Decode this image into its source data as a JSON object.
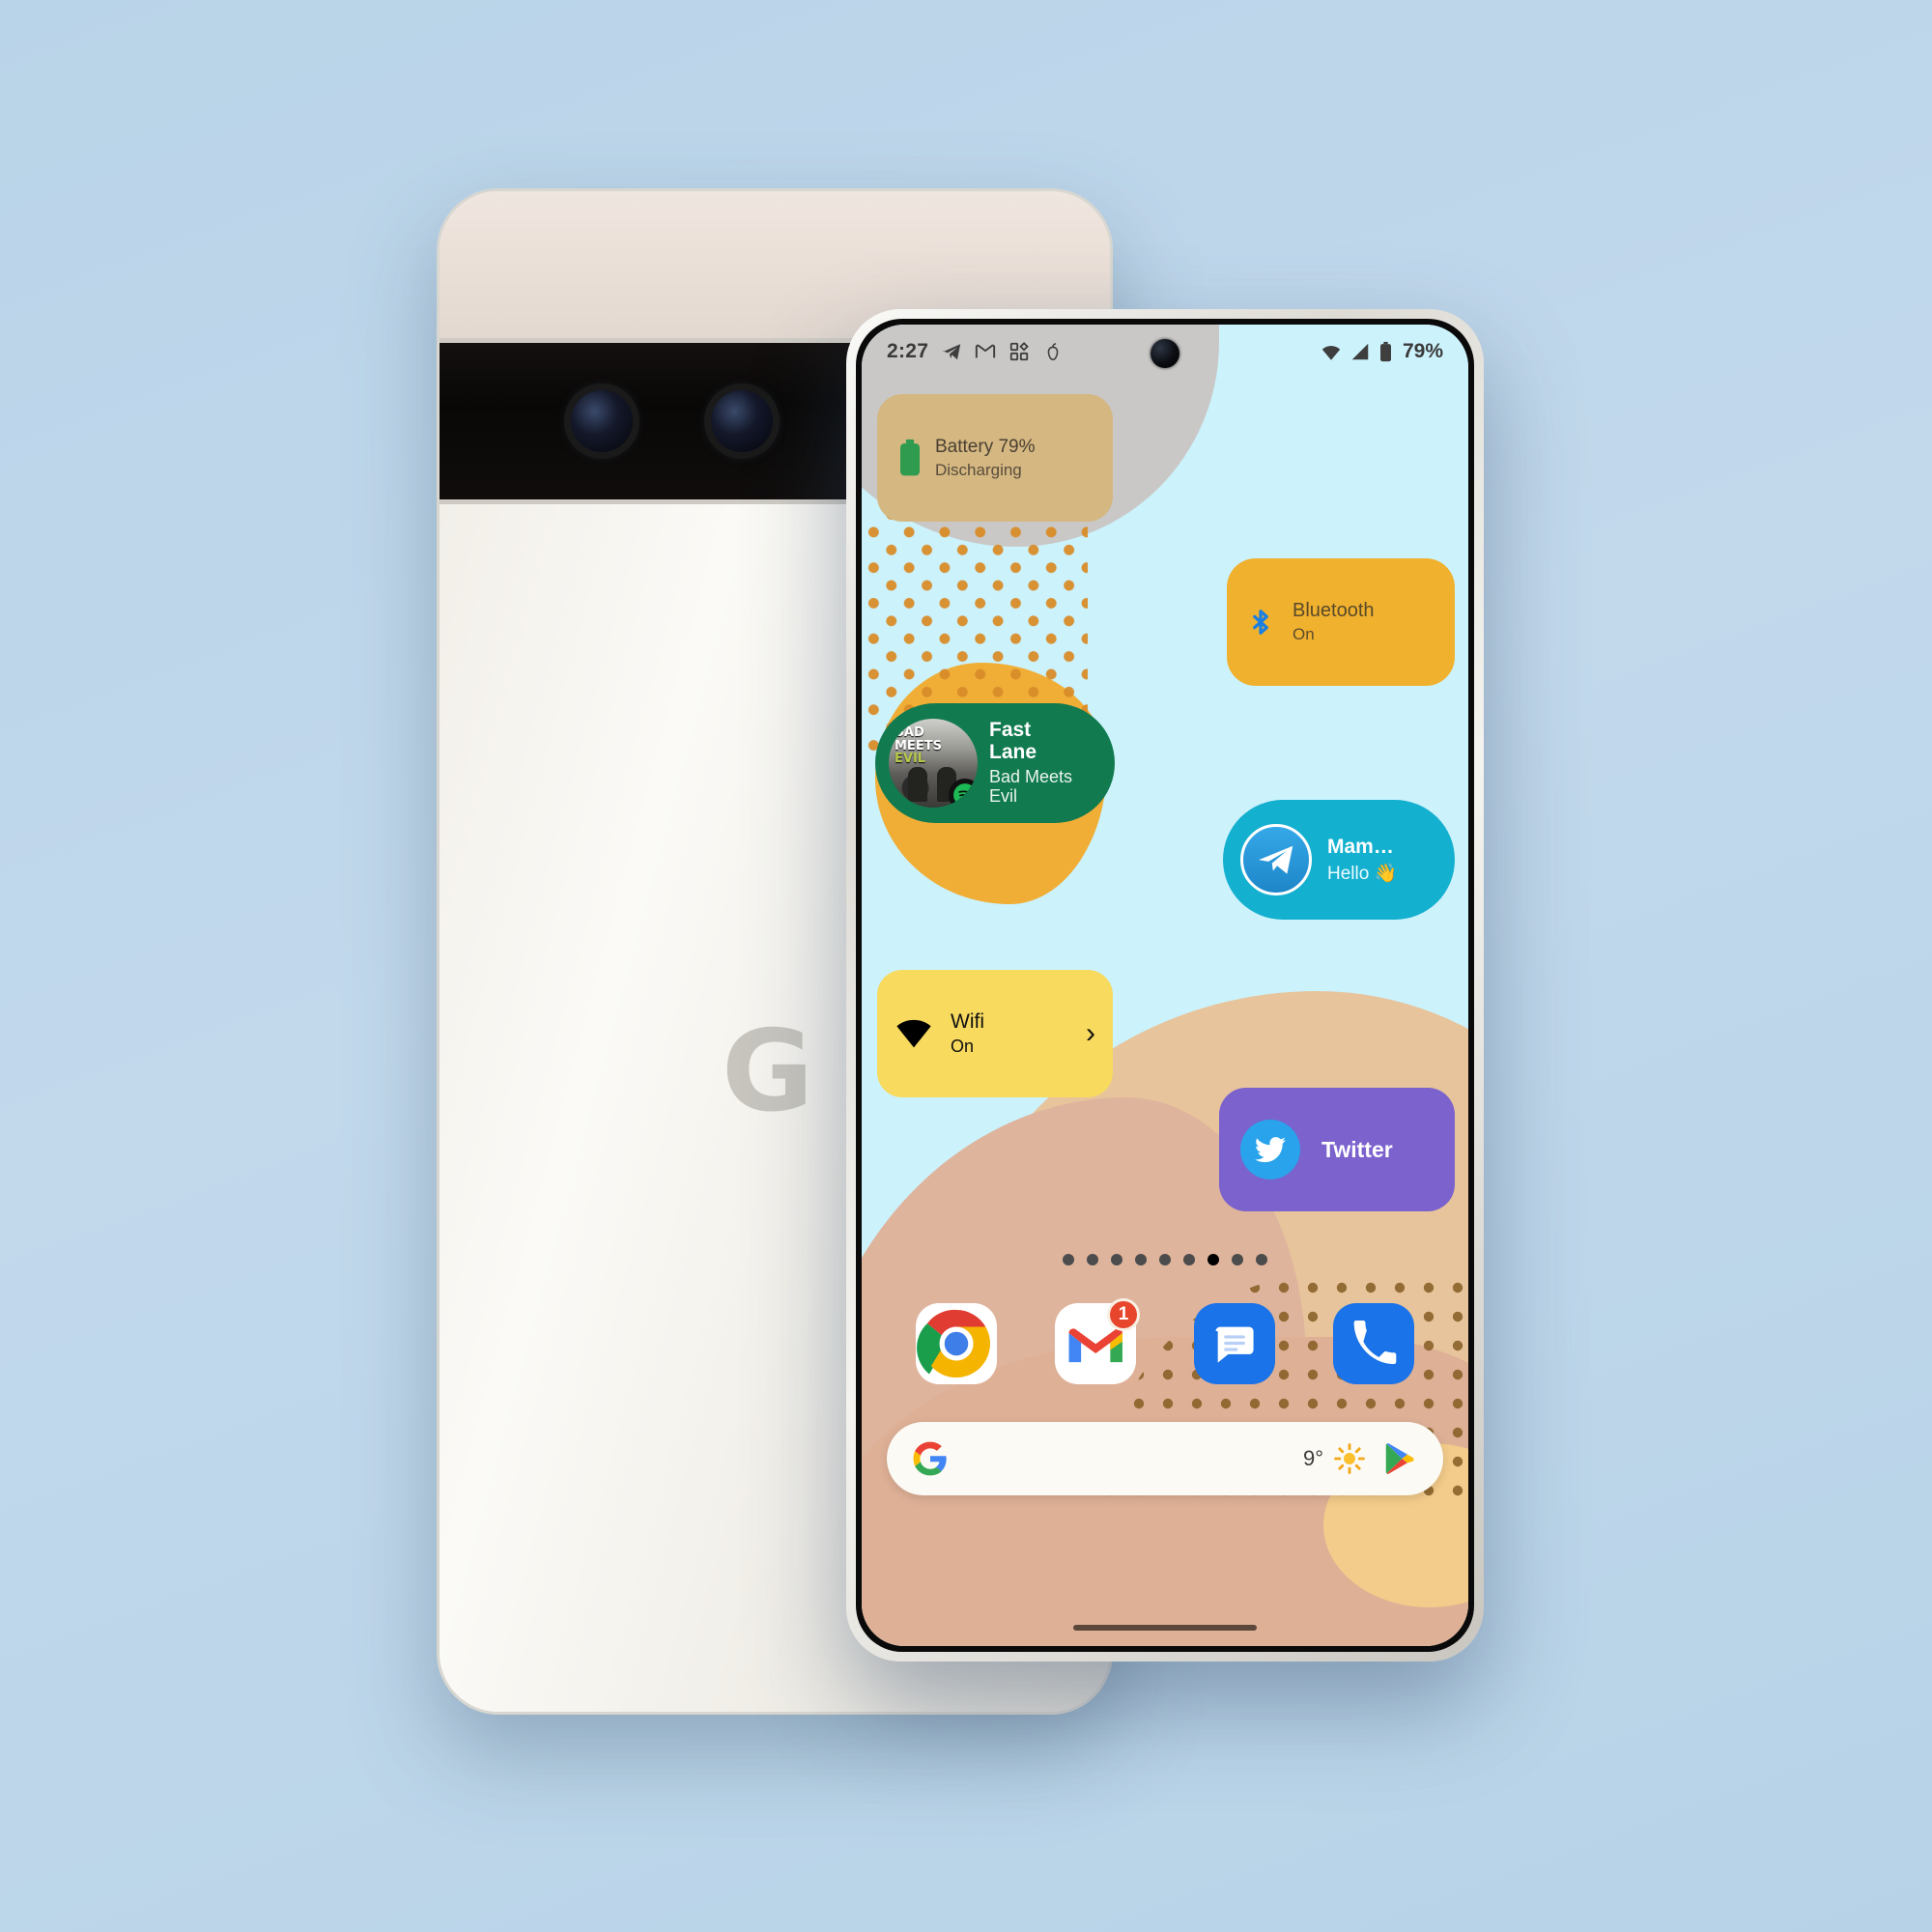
{
  "scene": {
    "background_color": "#bdd5e9",
    "back_device": {
      "name": "pixel-6-pro-back",
      "brand_mark": "G",
      "color": "#f2efe9"
    }
  },
  "status_bar": {
    "clock": "2:27",
    "notification_icons": [
      "telegram-icon",
      "gmail-icon",
      "apps-grid-icon",
      "apple-outline-icon"
    ],
    "system_icons": [
      "wifi-icon",
      "cellular-signal-icon",
      "battery-icon"
    ],
    "battery_percent": "79%"
  },
  "widgets": {
    "battery": {
      "title": "Battery 79%",
      "subtitle": "Discharging",
      "icon": "battery-icon",
      "color": "#d4b781"
    },
    "bluetooth": {
      "title": "Bluetooth",
      "subtitle": "On",
      "icon": "bluetooth-icon",
      "color": "#f0b12e"
    },
    "spotify": {
      "song": "Fast Lane",
      "artist": "Bad Meets Evil",
      "album_art_line1": "BAD",
      "album_art_line2": "MEETS",
      "album_art_line3": "EVIL",
      "icon": "spotify-icon",
      "color": "#127a4f"
    },
    "telegram": {
      "contact": "Mam…",
      "message": "Hello 👋",
      "icon": "telegram-icon",
      "color": "#14b0cf"
    },
    "wifi": {
      "title": "Wifi",
      "subtitle": "On",
      "icon": "wifi-icon",
      "chevron": "›",
      "color": "#f7da5e"
    },
    "twitter": {
      "label": "Twitter",
      "icon": "twitter-icon",
      "color": "#7b62cd"
    }
  },
  "home_screen": {
    "page_dots": {
      "count": 9,
      "active_index": 6
    },
    "dock": [
      {
        "label": "Chrome",
        "icon": "chrome-icon"
      },
      {
        "label": "Gmail",
        "icon": "gmail-icon",
        "badge": "1"
      },
      {
        "label": "Messages",
        "icon": "messages-icon"
      },
      {
        "label": "Phone",
        "icon": "phone-icon"
      }
    ],
    "search_bar": {
      "logo": "google-g-icon",
      "temperature": "9°",
      "weather_icon": "sun-icon",
      "store_icon": "google-play-icon"
    },
    "nav_pill": "gesture-nav-pill"
  }
}
